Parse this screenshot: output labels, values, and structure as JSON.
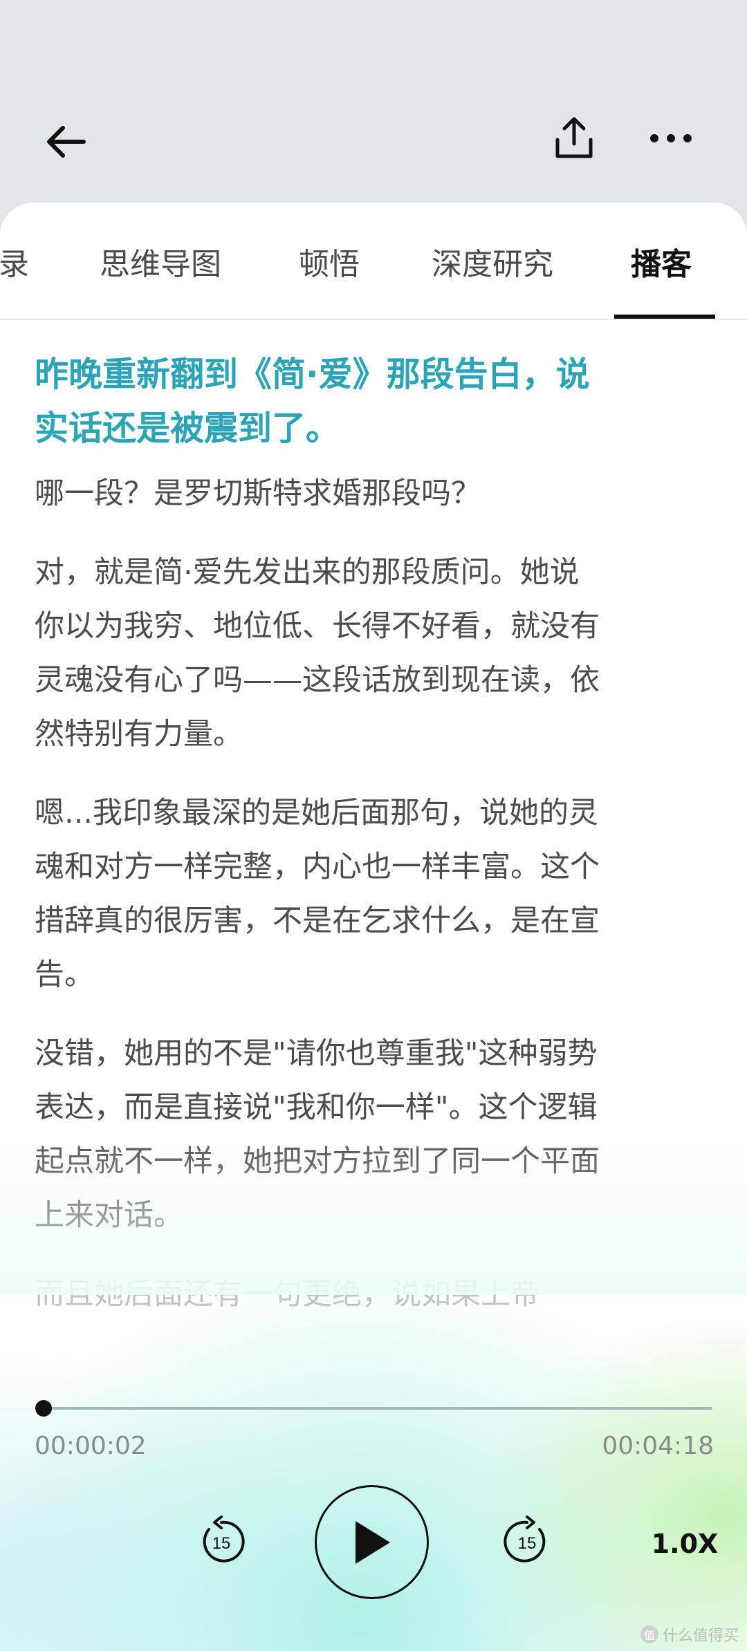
{
  "tabs": [
    {
      "label": "录"
    },
    {
      "label": "思维导图"
    },
    {
      "label": "顿悟"
    },
    {
      "label": "深度研究"
    },
    {
      "label": "播客"
    }
  ],
  "active_tab": "播客",
  "content": {
    "title": "昨晚重新翻到《简·爱》那段告白，说实话还是被震到了。",
    "paragraphs": [
      "哪一段？是罗切斯特求婚那段吗？",
      "对，就是简·爱先发出来的那段质问。她说你以为我穷、地位低、长得不好看，就没有灵魂没有心了吗——这段话放到现在读，依然特别有力量。",
      "嗯...我印象最深的是她后面那句，说她的灵魂和对方一样完整，内心也一样丰富。这个措辞真的很厉害，不是在乞求什么，是在宣告。",
      "没错，她用的不是\"请你也尊重我\"这种弱势表达，而是直接说\"我和你一样\"。这个逻辑起点就不一样，她把对方拉到了同一个平面上来对话。",
      "而且她后面还有一句更绝，说如果上帝"
    ]
  },
  "player": {
    "current_time": "00:00:02",
    "total_time": "00:04:18",
    "progress": 0.008,
    "rewind_seconds": "15",
    "forward_seconds": "15",
    "speed": "1.0X"
  },
  "watermark": {
    "logo": "值",
    "text": "什么值得买"
  },
  "colors": {
    "title": "#2aa4b6",
    "background": "#e2e5ea",
    "sheet": "#ffffff"
  },
  "icons": {
    "back": "arrow-left-icon",
    "share": "share-icon",
    "more": "more-dots-icon",
    "play": "play-icon"
  }
}
